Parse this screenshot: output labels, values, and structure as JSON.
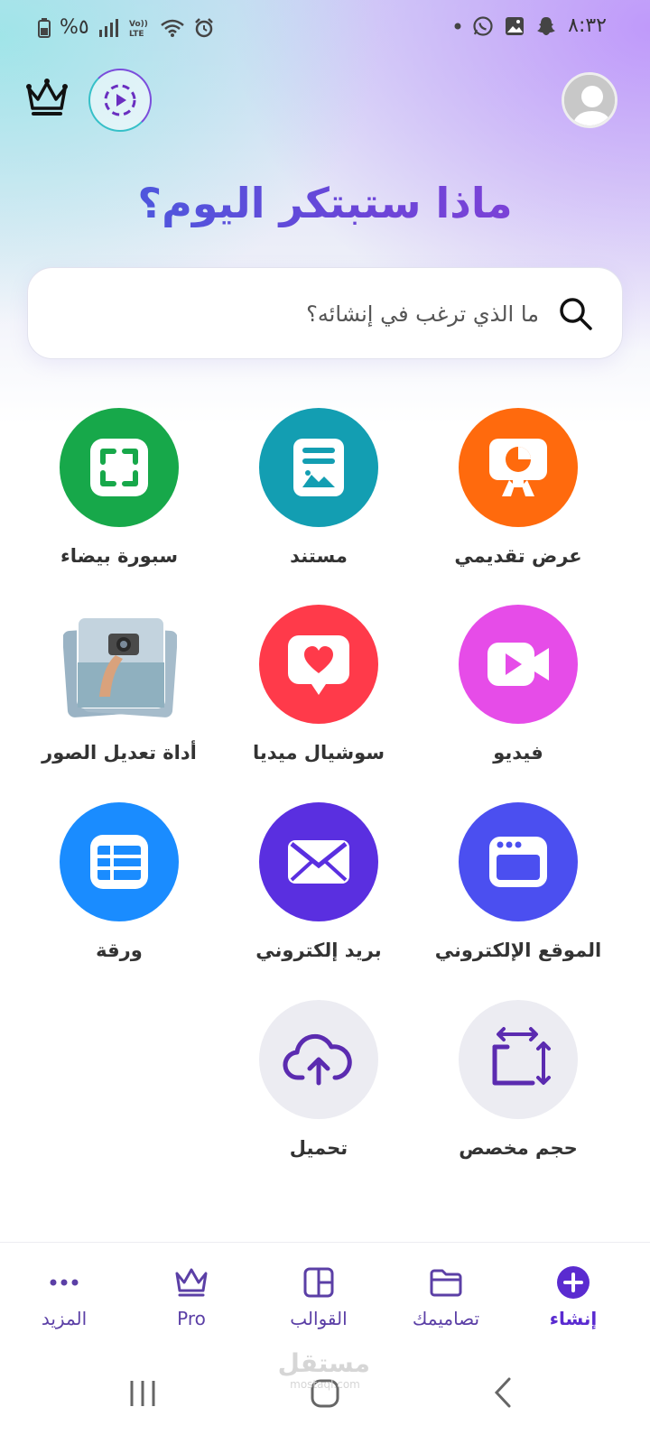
{
  "status_bar": {
    "time": "٨:٣٢",
    "battery": "%٥"
  },
  "main": {
    "title": "ماذا ستبتكر اليوم؟",
    "search_placeholder": "ما الذي ترغب في إنشائه؟"
  },
  "categories": [
    {
      "label": "عرض تقديمي",
      "icon": "presentation-icon",
      "color": "#ff6a0d"
    },
    {
      "label": "مستند",
      "icon": "document-icon",
      "color": "#139eb2"
    },
    {
      "label": "سبورة بيضاء",
      "icon": "whiteboard-icon",
      "color": "#17a84a"
    },
    {
      "label": "فيديو",
      "icon": "video-icon",
      "color": "#e64ce8"
    },
    {
      "label": "سوشيال ميديا",
      "icon": "social-media-icon",
      "color": "#ff3a4a"
    },
    {
      "label": "أداة تعديل الصور",
      "icon": "photo-editor-image",
      "color": "#7aa0b8"
    },
    {
      "label": "الموقع الإلكتروني",
      "icon": "website-icon",
      "color": "#4b4ff0"
    },
    {
      "label": "بريد إلكتروني",
      "icon": "email-icon",
      "color": "#5a2fe0"
    },
    {
      "label": "ورقة",
      "icon": "sheet-icon",
      "color": "#1a8cff"
    },
    {
      "label": "حجم مخصص",
      "icon": "custom-size-icon",
      "color": "#ececf2"
    },
    {
      "label": "تحميل",
      "icon": "upload-icon",
      "color": "#ececf2"
    }
  ],
  "bottom_nav": [
    {
      "label": "إنشاء",
      "icon": "plus-circle-icon",
      "active": true
    },
    {
      "label": "تصاميمك",
      "icon": "folder-icon",
      "active": false
    },
    {
      "label": "القوالب",
      "icon": "templates-icon",
      "active": false
    },
    {
      "label": "Pro",
      "icon": "crown-icon",
      "active": false
    },
    {
      "label": "المزيد",
      "icon": "more-icon",
      "active": false
    }
  ],
  "watermark": {
    "main": "مستقل",
    "sub": "mostaql.com"
  },
  "colors": {
    "accent": "#5a2bd0",
    "nav": "#5b3fa6",
    "icon_purple": "#6a2fc0"
  }
}
